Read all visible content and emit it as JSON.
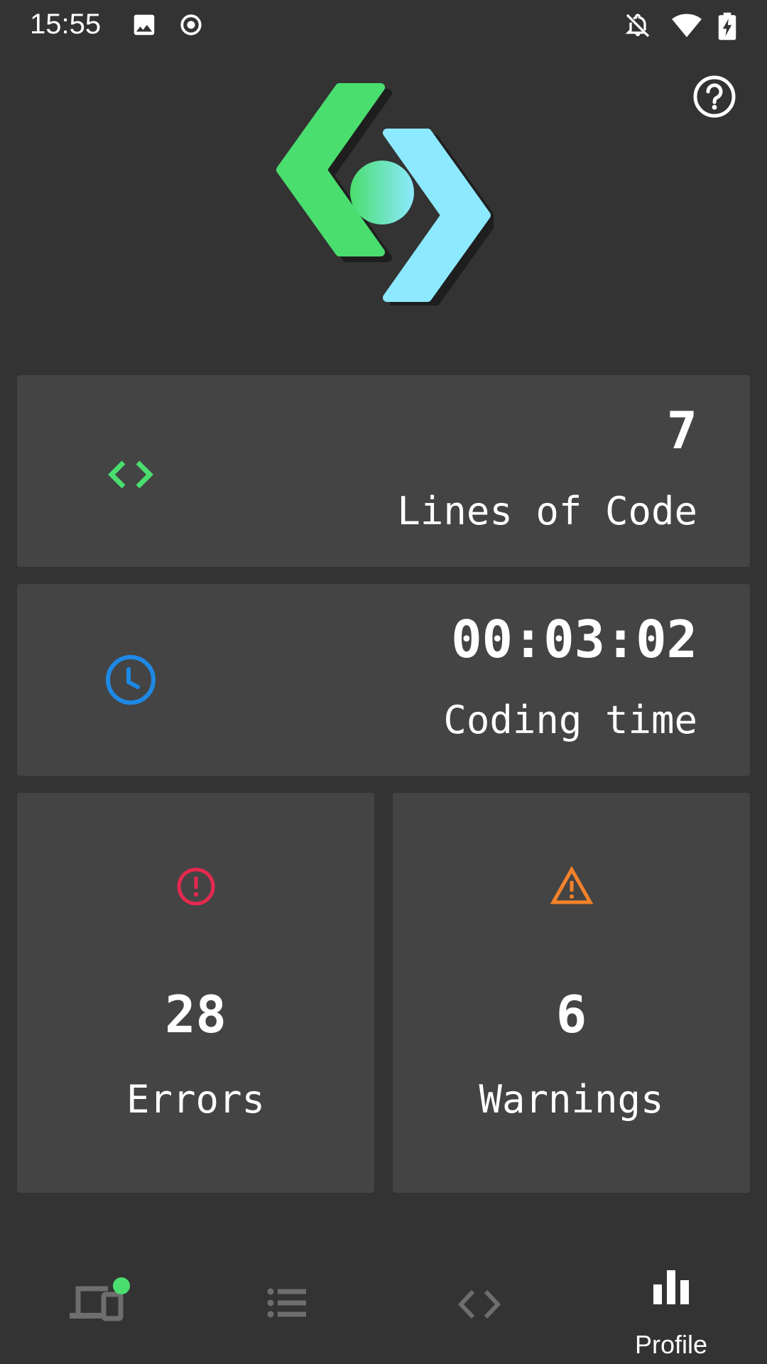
{
  "status_bar": {
    "time": "15:55",
    "icons": [
      "image-icon",
      "record-icon",
      "notifications-off-icon",
      "wifi-icon",
      "battery-charging-icon"
    ]
  },
  "header": {
    "help_icon": "help-circle-icon",
    "logo": "app-logo-code-brackets"
  },
  "stats": {
    "lines_of_code": {
      "value": "7",
      "label": "Lines of Code",
      "icon": "code-icon",
      "color": "#4ADE6E"
    },
    "coding_time": {
      "value": "00:03:02",
      "label": "Coding time",
      "icon": "clock-icon",
      "color": "#1E88E5"
    },
    "errors": {
      "value": "28",
      "label": "Errors",
      "icon": "error-circle-icon",
      "color": "#E5294F"
    },
    "warnings": {
      "value": "6",
      "label": "Warnings",
      "icon": "warning-triangle-icon",
      "color": "#F5822A"
    }
  },
  "bottom_nav": {
    "items": [
      {
        "name": "devices",
        "icon": "devices-icon",
        "badge_color": "#4ADE6E"
      },
      {
        "name": "list",
        "icon": "list-icon"
      },
      {
        "name": "code",
        "icon": "code-icon"
      },
      {
        "name": "profile",
        "icon": "bar-chart-icon",
        "label": "Profile",
        "active": true
      }
    ]
  },
  "colors": {
    "background": "#333333",
    "card": "#444444",
    "logo_green": "#4ADE6E",
    "logo_cyan": "#8DE9FF",
    "nav_inactive": "#6E6E6E"
  }
}
